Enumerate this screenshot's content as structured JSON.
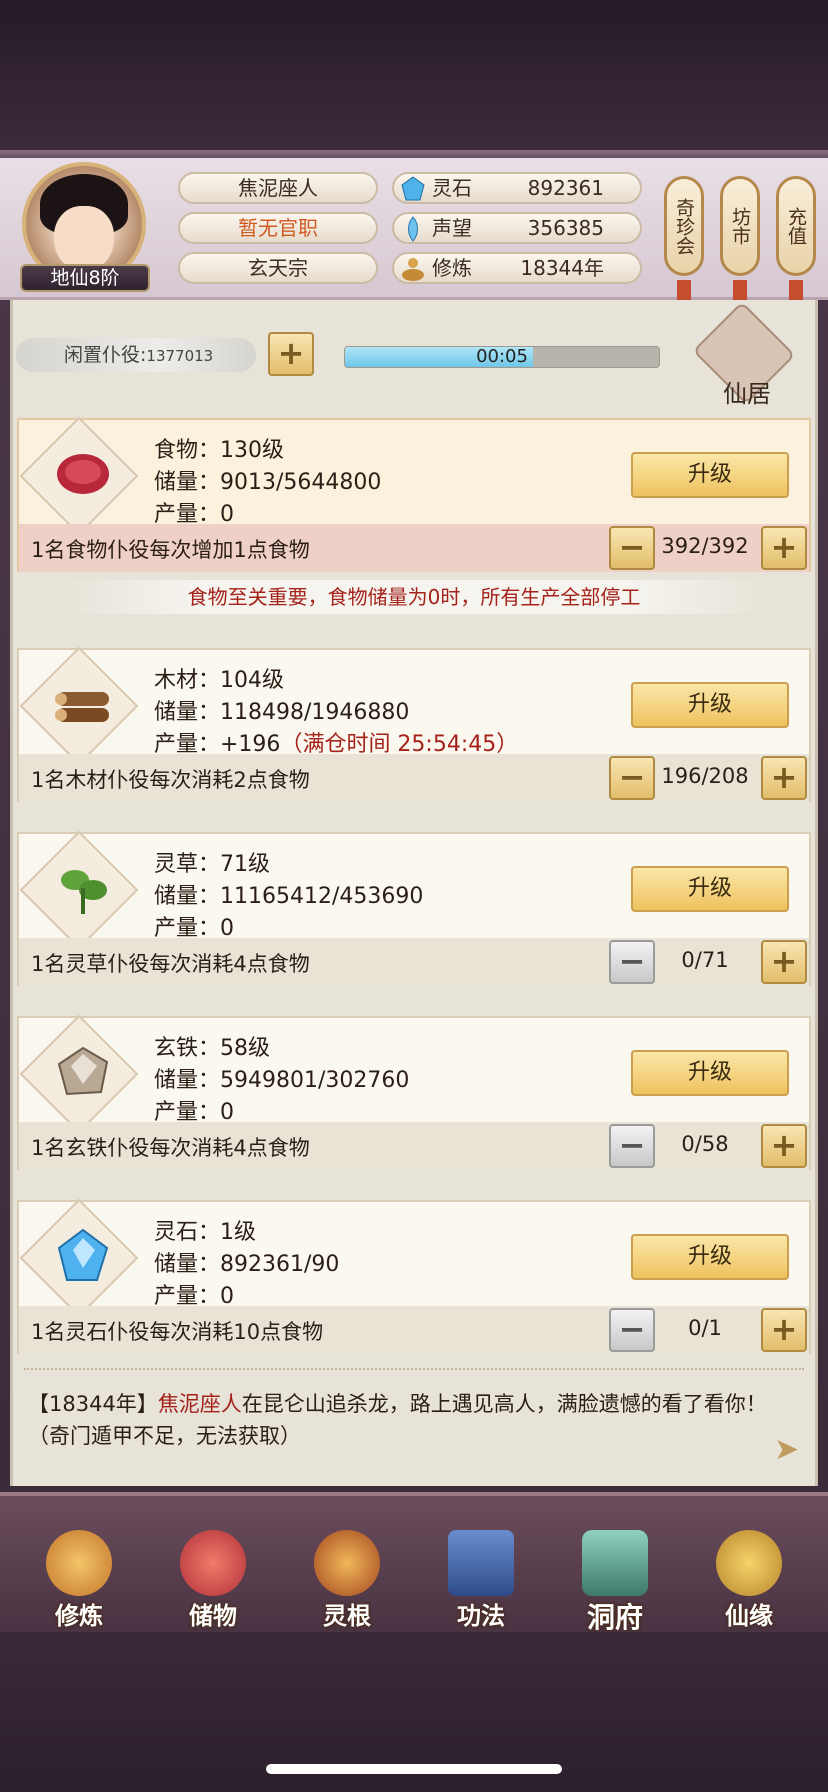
{
  "header": {
    "rank": "地仙8阶",
    "player_name": "焦泥座人",
    "official_title": "暂无官职",
    "sect": "玄天宗",
    "resources": [
      {
        "icon": "spirit-stone-icon",
        "label": "灵石",
        "value": "892361"
      },
      {
        "icon": "reputation-icon",
        "label": "声望",
        "value": "356385"
      },
      {
        "icon": "cultivation-icon",
        "label": "修炼",
        "value": "18344年"
      }
    ],
    "side_buttons": [
      "奇珍会",
      "坊市",
      "充值"
    ]
  },
  "idle": {
    "label": "闲置仆役:",
    "count": "1377013",
    "timer": "00:05",
    "timer_progress": 0.6,
    "home_label": "仙居"
  },
  "cards": [
    {
      "name": "food",
      "icon": "meat-icon",
      "line1": "食物：130级",
      "line2": "储量：9013/5644800",
      "line3": "产量：0",
      "line3_extra": "",
      "upgrade": "升级",
      "worker": "1名食物仆役每次增加1点食物",
      "count": "392/392"
    },
    {
      "name": "wood",
      "icon": "wood-icon",
      "line1": "木材：104级",
      "line2": "储量：118498/1946880",
      "line3": "产量：+196",
      "line3_extra": "（满仓时间 25:54:45）",
      "upgrade": "升级",
      "worker": "1名木材仆役每次消耗2点食物",
      "count": "196/208"
    },
    {
      "name": "herb",
      "icon": "herb-icon",
      "line1": "灵草：71级",
      "line2": "储量：11165412/453690",
      "line3": "产量：0",
      "line3_extra": "",
      "upgrade": "升级",
      "worker": "1名灵草仆役每次消耗4点食物",
      "count": "0/71"
    },
    {
      "name": "iron",
      "icon": "ore-icon",
      "line1": "玄铁：58级",
      "line2": "储量：5949801/302760",
      "line3": "产量：0",
      "line3_extra": "",
      "upgrade": "升级",
      "worker": "1名玄铁仆役每次消耗4点食物",
      "count": "0/58"
    },
    {
      "name": "stone",
      "icon": "crystal-icon",
      "line1": "灵石：1级",
      "line2": "储量：892361/90",
      "line3": "产量：0",
      "line3_extra": "",
      "upgrade": "升级",
      "worker": "1名灵石仆役每次消耗10点食物",
      "count": "0/1"
    }
  ],
  "warning": "食物至关重要，食物储量为0时，所有生产全部停工",
  "log": {
    "prefix": "【18344年】",
    "name": "焦泥座人",
    "text": "在昆仑山追杀龙，路上遇见高人，满脸遗憾的看了看你！（奇门遁甲不足，无法获取）"
  },
  "nav": [
    "修炼",
    "储物",
    "灵根",
    "功法",
    "洞府",
    "仙缘"
  ],
  "colors": {
    "accent_red": "#a4221a",
    "gold": "#eec25f"
  }
}
